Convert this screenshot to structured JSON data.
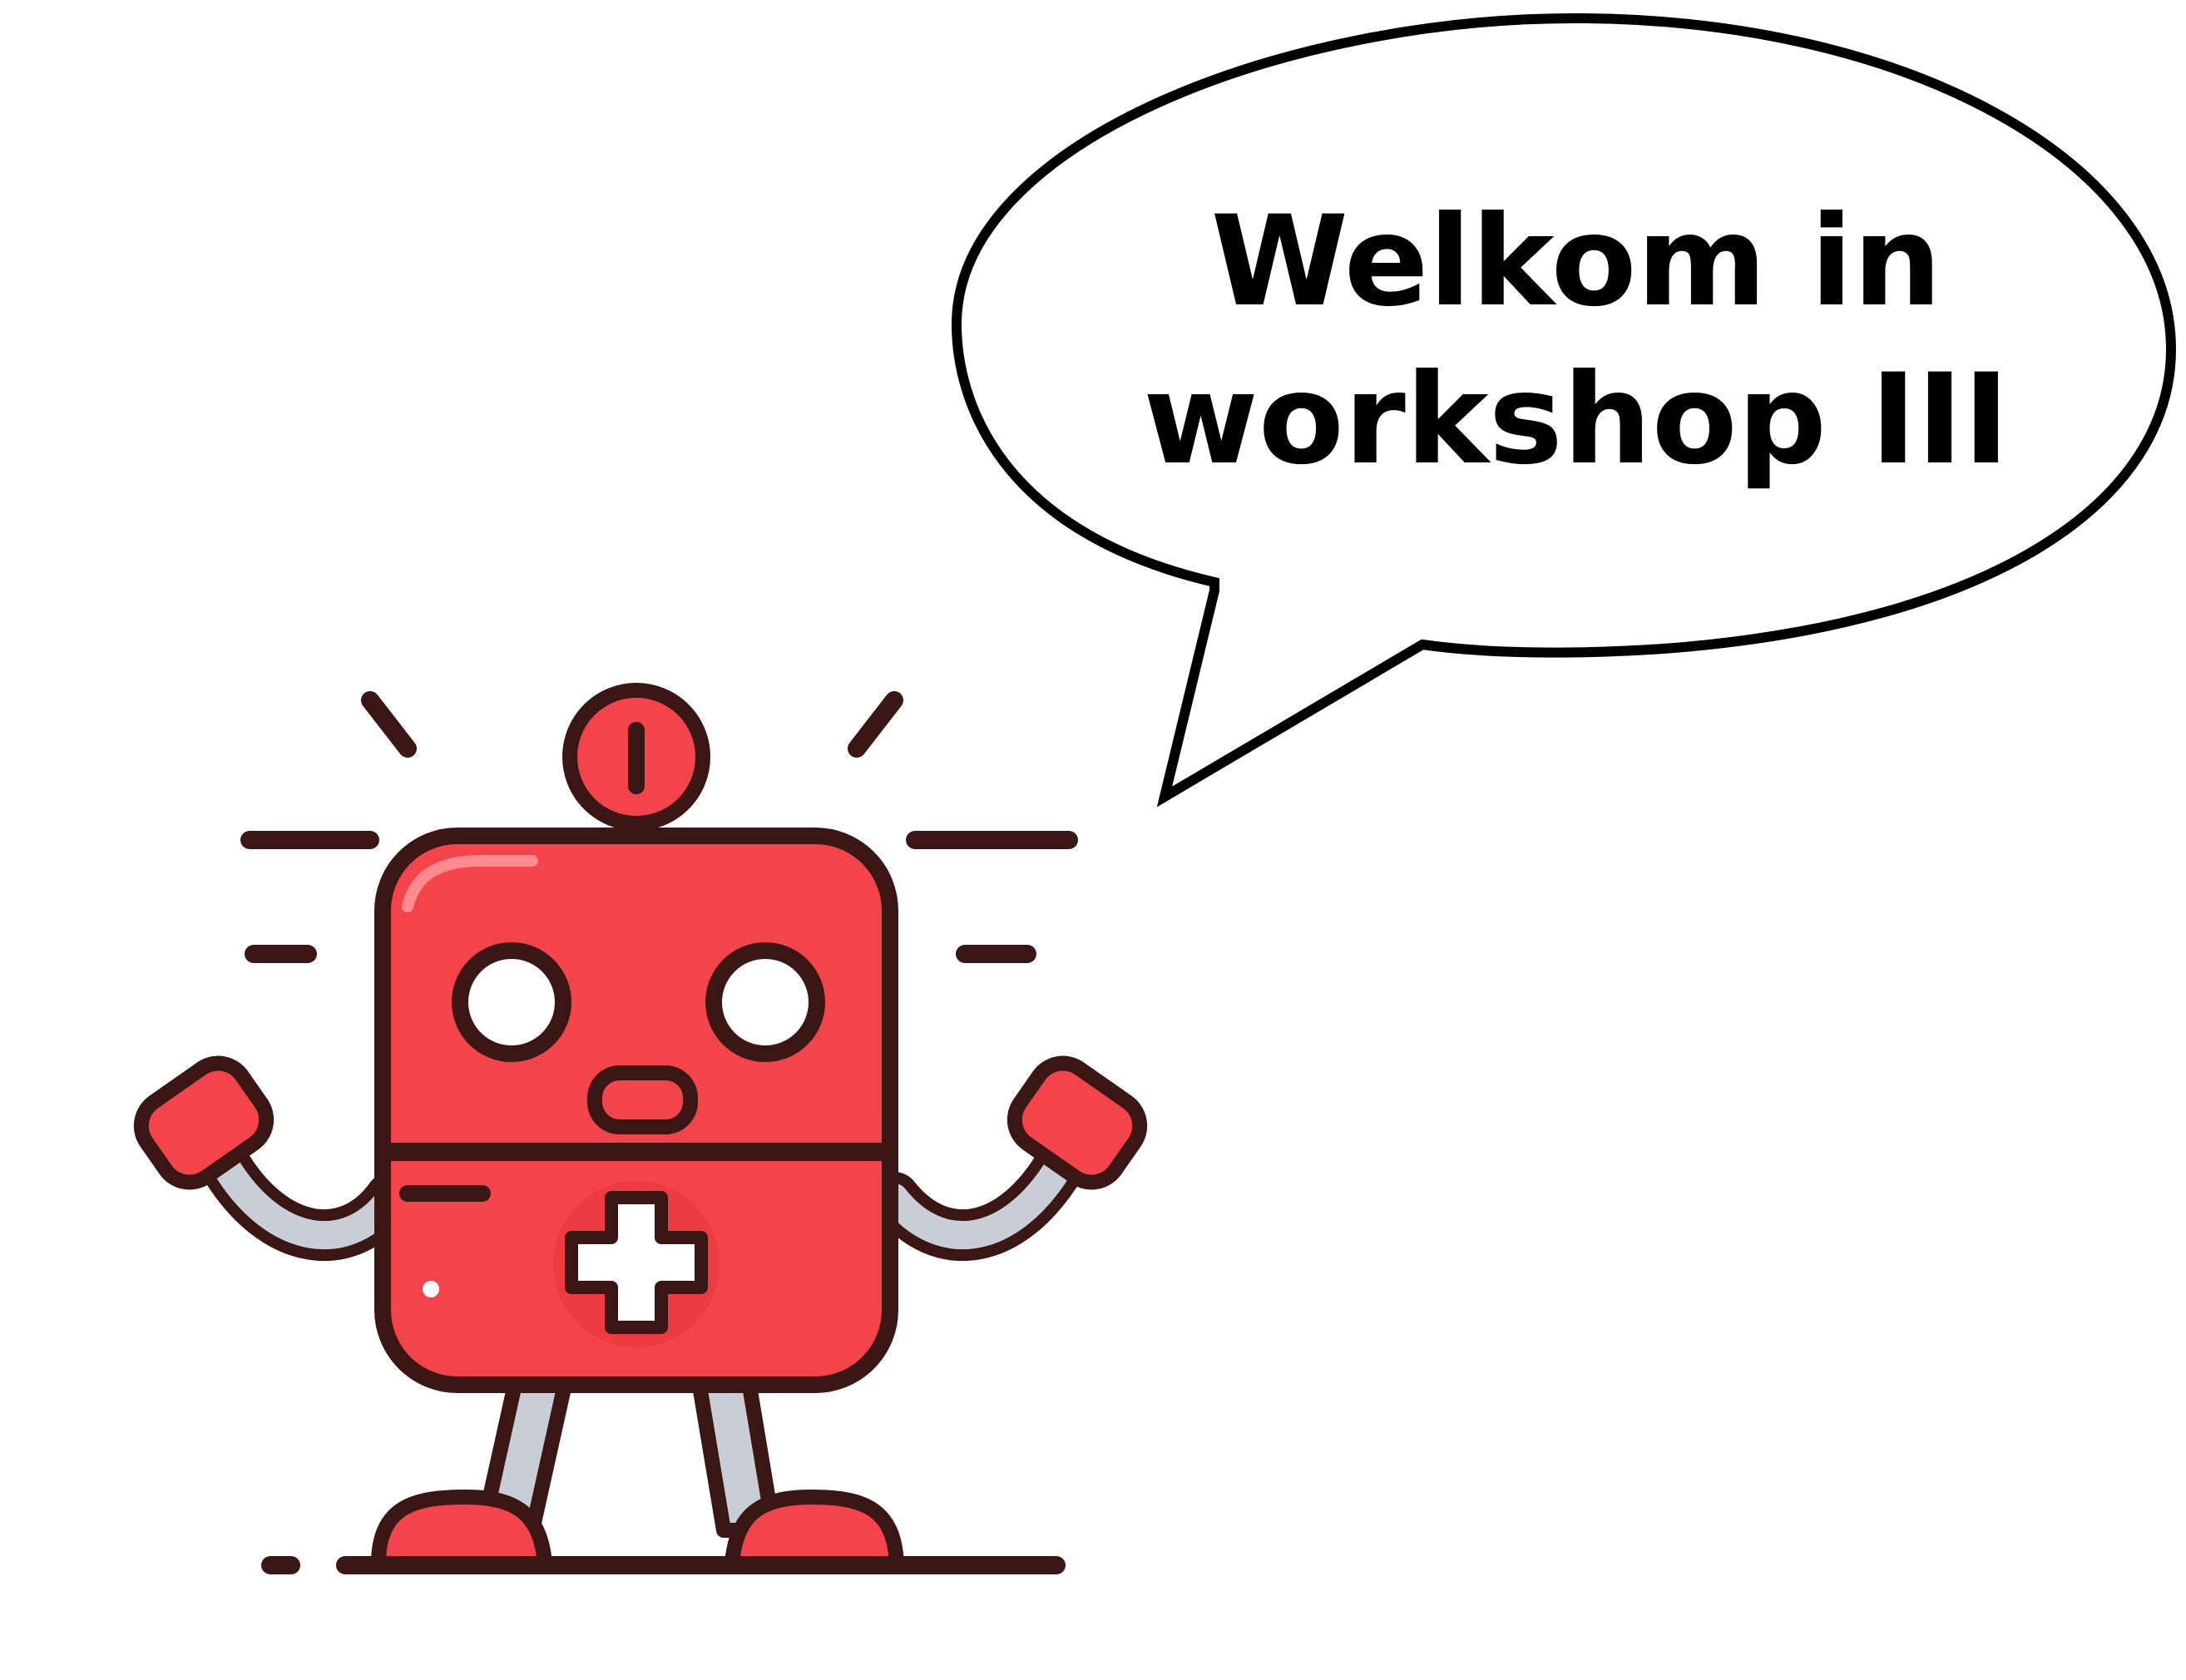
{
  "speech_bubble": {
    "line1": "Welkom in",
    "line2": "workshop III"
  },
  "colors": {
    "robot_red": "#f2444a",
    "robot_red_dark": "#e02f36",
    "outline": "#3a1614",
    "limb_gray": "#c9ced6",
    "white": "#ffffff",
    "background": "#ffffff"
  },
  "icons": [
    "first-aid-robot-mascot",
    "speech-bubble",
    "plus-cross-icon"
  ]
}
